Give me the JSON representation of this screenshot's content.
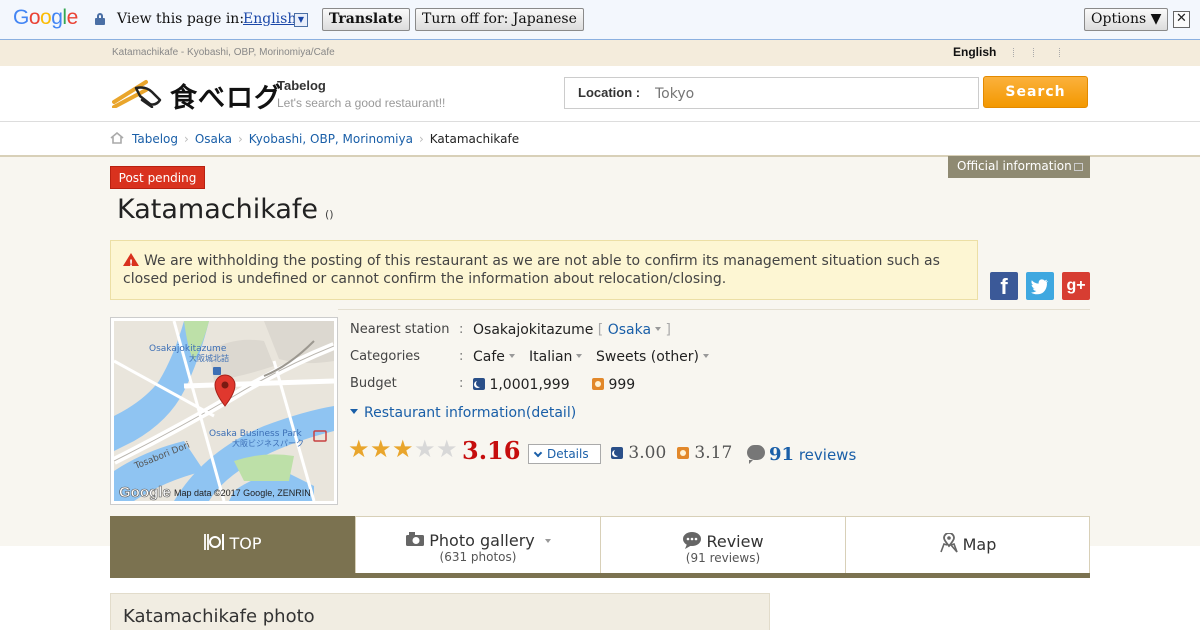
{
  "translate_bar": {
    "logo": [
      "G",
      "o",
      "o",
      "g",
      "l",
      "e"
    ],
    "label": "View this page in:",
    "language": "English",
    "translate_button": "Translate",
    "turn_off_button": "Turn off for: Japanese",
    "options_button": "Options ▼",
    "close": "✕"
  },
  "top_strip": {
    "crumbs": "Katamachikafe - Kyobashi, OBP, Morinomiya/Cafe",
    "language": "English"
  },
  "header": {
    "logo_text": "食べログ",
    "brand_name": "Tabelog",
    "brand_tagline": "Let's search a good restaurant!!",
    "location_label": "Location :",
    "location_placeholder": "Tokyo",
    "search_button": "Search"
  },
  "breadcrumb": [
    {
      "label": "Tabelog",
      "link": true
    },
    {
      "label": "Osaka",
      "link": true
    },
    {
      "label": "Kyobashi, OBP, Morinomiya",
      "link": true
    },
    {
      "label": "Katamachikafe",
      "link": false
    }
  ],
  "status_badge": "Post pending",
  "official_info": "Official information",
  "shop": {
    "name": "Katamachikafe",
    "name_sub": "()"
  },
  "notice": "We are withholding the posting of this restaurant as we are not able to confirm its management situation such as closed period is undefined or cannot confirm the information about relocation/closing.",
  "social": {
    "facebook": "f",
    "google_plus": "g+"
  },
  "map": {
    "labels": {
      "station_en": "Osakajokitazume",
      "station_jp": "大阪城北詰",
      "park_en": "Osaka Business Park",
      "park_jp": "大阪ビジネスパーク",
      "road": "Tosabori Dori",
      "brand": "Google",
      "attribution": "Map data ©2017 Google, ZENRIN"
    }
  },
  "info": {
    "station_label": "Nearest station",
    "station_value": "Osakajokitazume",
    "station_city": "Osaka",
    "categories_label": "Categories",
    "categories": [
      "Cafe",
      "Italian",
      "Sweets (other)"
    ],
    "budget_label": "Budget",
    "budget_dinner": "1,0001,999",
    "budget_lunch": "999",
    "detail_link": "Restaurant information(detail)"
  },
  "rating": {
    "stars": 3,
    "max_stars": 5,
    "score": "3.16",
    "details_button": "Details",
    "dinner_score": "3.00",
    "lunch_score": "3.17",
    "reviews_count": "91",
    "reviews_label": "reviews"
  },
  "tabs": [
    {
      "label": "TOP",
      "sub": ""
    },
    {
      "label": "Photo gallery",
      "sub": "(631 photos)"
    },
    {
      "label": "Review",
      "sub": "(91 reviews)"
    },
    {
      "label": "Map",
      "sub": ""
    }
  ],
  "photo_section_title": "Katamachikafe photo",
  "colors": {
    "accent_orange": "#f39800",
    "score_red": "#c60d0d",
    "tab_active": "#7b7250",
    "link_blue": "#1a5fa8",
    "badge_red": "#d9321e"
  }
}
